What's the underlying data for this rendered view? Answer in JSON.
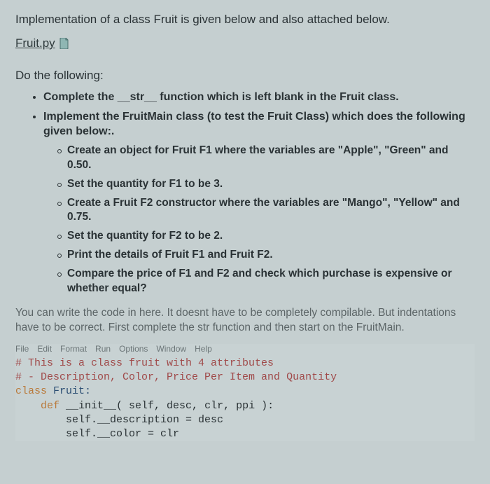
{
  "intro": "Implementation of a class Fruit is given below and also attached below.",
  "file_link": {
    "label": "Fruit.py",
    "icon": "file-icon"
  },
  "do_heading": "Do the following:",
  "bullets": {
    "b1": "Complete the __str__ function which is left blank in the Fruit class.",
    "b2": "Implement the FruitMain class (to test the Fruit Class) which does the following given below:."
  },
  "subbullets": {
    "s1": "Create an object for Fruit F1 where the variables are \"Apple\", \"Green\" and 0.50.",
    "s2": "Set the quantity for F1 to be 3.",
    "s3": "Create a Fruit F2 constructor where the variables are \"Mango\", \"Yellow\" and 0.75.",
    "s4": "Set the quantity for F2 to be 2.",
    "s5": "Print the details of Fruit F1 and Fruit F2.",
    "s6": "Compare the price of F1 and F2 and check which purchase is expensive or whether equal?"
  },
  "note": "You can write the code in here. It doesnt have to be completely compilable. But indentations have to be correct. First complete the str function and then start on the FruitMain.",
  "menubar": {
    "file": "File",
    "edit": "Edit",
    "format": "Format",
    "run": "Run",
    "options": "Options",
    "window": "Window",
    "help": "Help"
  },
  "code": {
    "c1a": "# This is a class fruit with 4 attributes",
    "c2a": "# - Description, Color, Price Per Item and Quantity",
    "kw_class": "class",
    "cls_name": " Fruit:",
    "kw_def": "def",
    "init": " __init__( self, desc, clr, ppi ):",
    "l5": "self.__description = desc",
    "l6": "self.__color = clr"
  }
}
